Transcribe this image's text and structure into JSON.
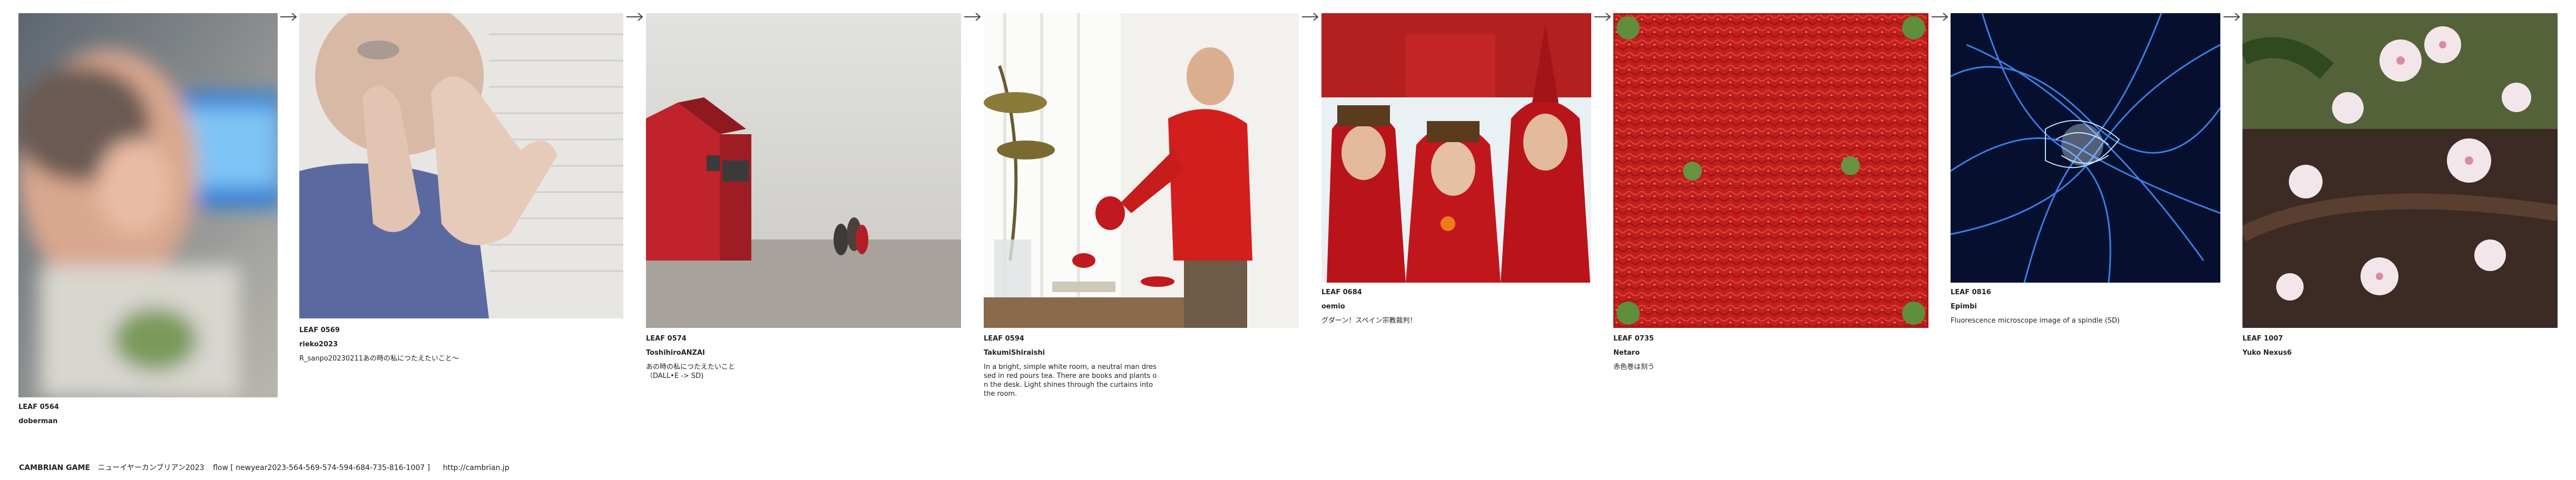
{
  "leaves": [
    {
      "id": "LEAF 0564",
      "author": "doberman",
      "title": ""
    },
    {
      "id": "LEAF 0569",
      "author": "rieko2023",
      "title": "R_sanpo20230211あの時の私につたえたいこと～"
    },
    {
      "id": "LEAF 0574",
      "author": "ToshihiroANZAI",
      "title": "あの時の私につたえたいこと\n（DALL•E -> SD)"
    },
    {
      "id": "LEAF 0594",
      "author": "TakumiShiraishi",
      "title": "In a bright, simple white room, a neutral man dres\nsed in red pours tea. There are books and plants o\nn the desk. Light shines through the curtains into\n the room."
    },
    {
      "id": "LEAF 0684",
      "author": "oemio",
      "title": "グダーン！スペイン宗教裁判！"
    },
    {
      "id": "LEAF 0735",
      "author": "Netaro",
      "title": "赤色巻は刻う"
    },
    {
      "id": "LEAF 0816",
      "author": "Epimbi",
      "title": "Fluorescence microscope image of a spindle (SD)"
    },
    {
      "id": "LEAF 1007",
      "author": "Yuko Nexus6",
      "title": ""
    }
  ],
  "arrow_icon": "right-arrow-icon",
  "footer": {
    "brand": "CAMBRIAN GAME",
    "subtitle": "ニューイヤーカンブリアン2023",
    "flow": "flow [ newyear2023-564-569-574-594-684-735-816-1007 ]",
    "url": "http://cambrian.jp"
  }
}
